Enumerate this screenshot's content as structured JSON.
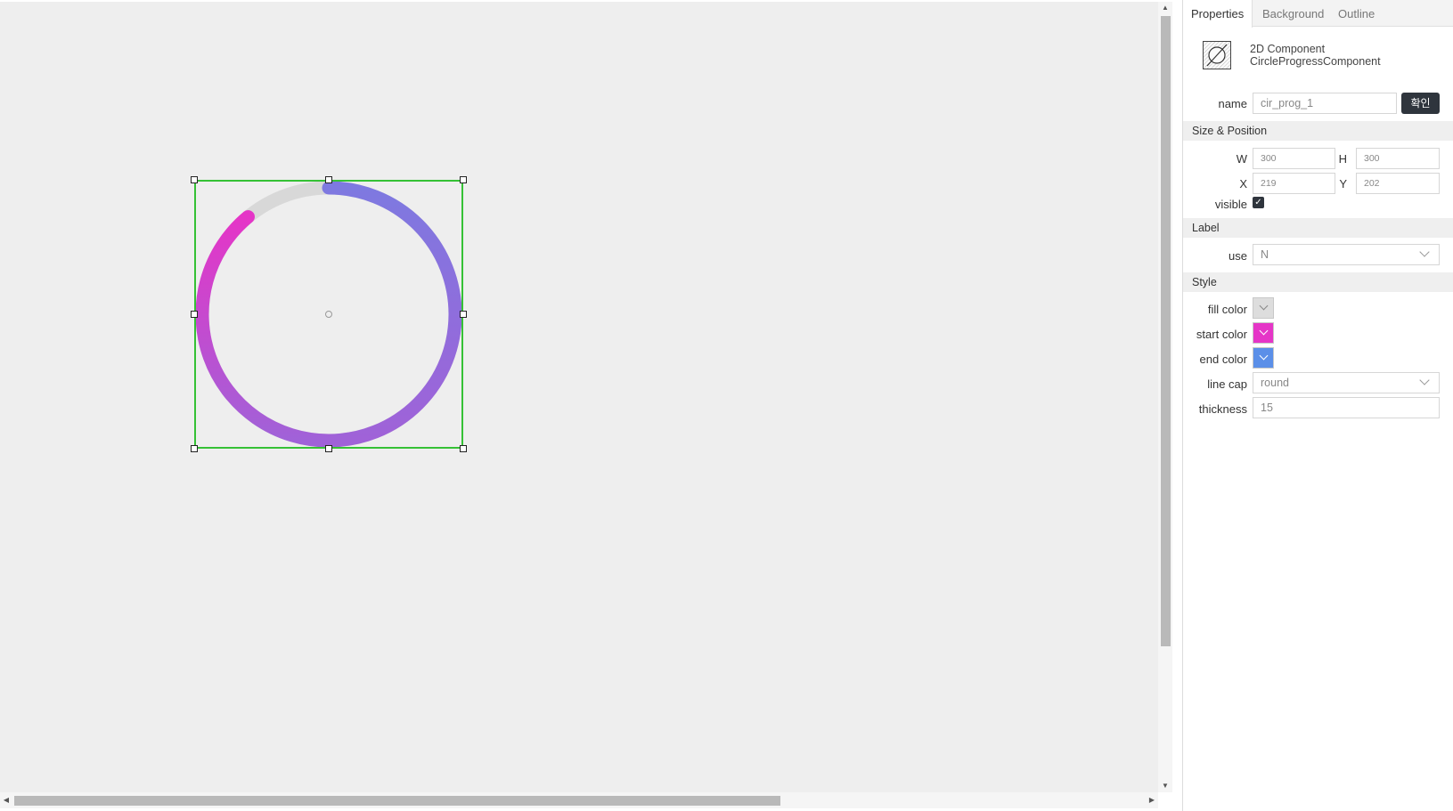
{
  "canvas": {
    "component": {
      "progress_percent": 89,
      "fill_color": "#d8d8d8",
      "start_color": "#e535c7",
      "end_color": "#5b8fe8"
    }
  },
  "panel": {
    "tabs": [
      {
        "label": "Properties"
      },
      {
        "label": "Background"
      },
      {
        "label": "Outline"
      }
    ],
    "component_type_line1": "2D Component",
    "component_type_line2": "CircleProgressComponent",
    "name_label": "name",
    "name_value": "cir_prog_1",
    "confirm_label": "확인",
    "size_position": {
      "section_title": "Size & Position",
      "w_label": "W",
      "w_value": "300",
      "h_label": "H",
      "h_value": "300",
      "x_label": "X",
      "x_value": "219",
      "y_label": "Y",
      "y_value": "202",
      "visible_label": "visible"
    },
    "label": {
      "section_title": "Label",
      "use_label": "use",
      "use_value": "N"
    },
    "style": {
      "section_title": "Style",
      "fill_color_label": "fill color",
      "fill_color": "#dddddd",
      "start_color_label": "start color",
      "start_color": "#e535c7",
      "end_color_label": "end color",
      "end_color": "#5b8fe8",
      "line_cap_label": "line cap",
      "line_cap_value": "round",
      "thickness_label": "thickness",
      "thickness_value": "15"
    }
  }
}
